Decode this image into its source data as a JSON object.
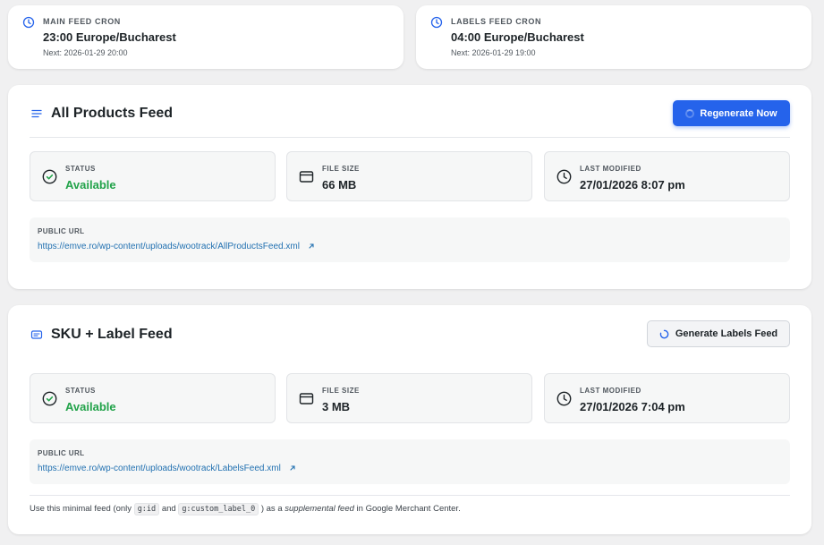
{
  "crons": {
    "main": {
      "label": "MAIN FEED CRON",
      "value": "23:00 Europe/Bucharest",
      "next": "Next: 2026-01-29 20:00"
    },
    "labels": {
      "label": "LABELS FEED CRON",
      "value": "04:00 Europe/Bucharest",
      "next": "Next: 2026-01-29 19:00"
    }
  },
  "feeds": {
    "all_products": {
      "title": "All Products Feed",
      "button": "Regenerate Now",
      "status_label": "STATUS",
      "status_value": "Available",
      "file_size_label": "FILE SIZE",
      "file_size_value": "66 MB",
      "modified_label": "LAST MODIFIED",
      "modified_value": "27/01/2026 8:07 pm",
      "url_label": "PUBLIC URL",
      "url": "https://emve.ro/wp-content/uploads/wootrack/AllProductsFeed.xml"
    },
    "sku_label": {
      "title": "SKU + Label Feed",
      "button": "Generate Labels Feed",
      "status_label": "STATUS",
      "status_value": "Available",
      "file_size_label": "FILE SIZE",
      "file_size_value": "3 MB",
      "modified_label": "LAST MODIFIED",
      "modified_value": "27/01/2026 7:04 pm",
      "url_label": "PUBLIC URL",
      "url": "https://emve.ro/wp-content/uploads/wootrack/LabelsFeed.xml",
      "note": {
        "prefix": "Use this minimal feed (only",
        "code1": "g:id",
        "and": "and",
        "code2": "g:custom_label_0",
        "middle": ") as a",
        "emphasis": "supplemental feed",
        "suffix": "in Google Merchant Center."
      }
    }
  },
  "colors": {
    "accent": "#2563eb",
    "link": "#2271b1",
    "success": "#22a34a"
  },
  "icons": [
    "clock-icon",
    "list-icon",
    "check-circle-icon",
    "file-icon",
    "external-link-icon",
    "message-icon",
    "spinner-icon"
  ]
}
